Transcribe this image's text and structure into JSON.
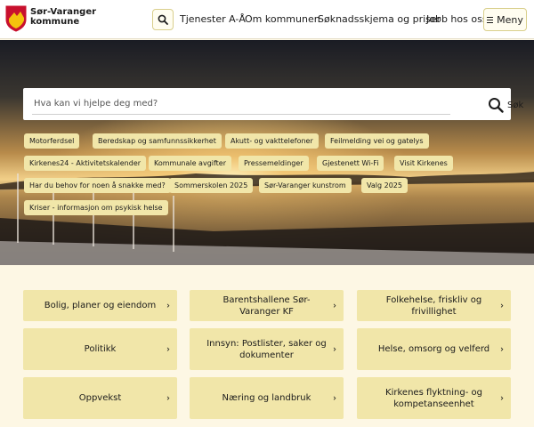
{
  "header": {
    "logo_line1": "Sør-Varanger",
    "logo_line2": "kommune",
    "search_icon": "search-icon",
    "nav": [
      {
        "label": "Tjenester A-Å"
      },
      {
        "label": "Om kommunen"
      },
      {
        "label": "Søknadsskjema og priser"
      },
      {
        "label": "Jobb hos oss!"
      }
    ],
    "menu_label": "Meny"
  },
  "hero": {
    "search_placeholder": "Hva kan vi hjelpe deg med?",
    "search_button": "Søk",
    "chips": [
      {
        "label": "Motorferdsel"
      },
      {
        "label": "Beredskap og samfunnssikkerhet"
      },
      {
        "label": "Akutt- og vakttelefoner"
      },
      {
        "label": "Feilmelding vei og gatelys"
      },
      {
        "label": "Kirkenes24 - Aktivitetskalender"
      },
      {
        "label": "Kommunale avgifter"
      },
      {
        "label": "Pressemeldinger"
      },
      {
        "label": "Gjestenett Wi-Fi"
      },
      {
        "label": "Visit Kirkenes"
      },
      {
        "label": "Har du behov for noen å snakke med?"
      },
      {
        "label": "Sommerskolen 2025"
      },
      {
        "label": "Sør-Varanger kunstrom"
      },
      {
        "label": "Valg 2025"
      },
      {
        "label": "Kriser - informasjon om psykisk helse"
      }
    ]
  },
  "cards": [
    {
      "label": "Bolig, planer og eiendom"
    },
    {
      "label": "Barentshallene Sør-Varanger KF"
    },
    {
      "label": "Folkehelse, friskliv og frivillighet"
    },
    {
      "label": "Politikk"
    },
    {
      "label": "Innsyn: Postlister, saker og dokumenter"
    },
    {
      "label": "Helse, omsorg og velferd"
    },
    {
      "label": "Oppvekst"
    },
    {
      "label": "Næring og landbruk"
    },
    {
      "label": "Kirkenes flyktning- og kompetanseenhet"
    }
  ],
  "colors": {
    "accent": "#f1e6a9",
    "background": "#fdf7e4"
  }
}
